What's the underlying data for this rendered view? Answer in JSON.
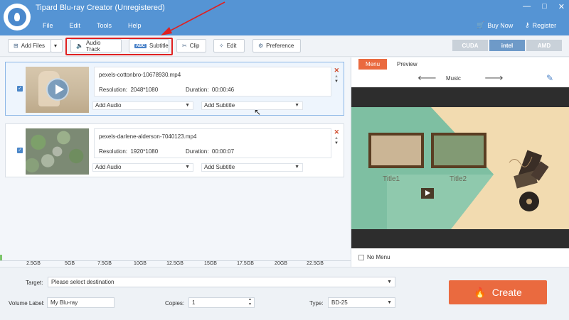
{
  "window": {
    "title": "Tipard Blu-ray Creator (Unregistered)",
    "menu": [
      "File",
      "Edit",
      "Tools",
      "Help"
    ],
    "buy_now": "Buy Now",
    "register": "Register",
    "controls": [
      "—",
      "□",
      "✕"
    ]
  },
  "toolbar": {
    "add_files": "Add Files",
    "audio_track": "Audio Track",
    "subtitle": "Subtitle",
    "clip": "Clip",
    "edit": "Edit",
    "preference": "Preference",
    "abc_badge": "ABC",
    "hw_accel": [
      "CUDA",
      "intel",
      "AMD"
    ]
  },
  "files": [
    {
      "name": "pexels-cottonbro-10678930.mp4",
      "resolution_label": "Resolution:",
      "resolution": "2048*1080",
      "duration_label": "Duration:",
      "duration": "00:00:46",
      "add_audio": "Add Audio",
      "add_subtitle": "Add Subtitle"
    },
    {
      "name": "pexels-darlene-alderson-7040123.mp4",
      "resolution_label": "Resolution:",
      "resolution": "1920*1080",
      "duration_label": "Duration:",
      "duration": "00:00:07",
      "add_audio": "Add Audio",
      "add_subtitle": "Add Subtitle"
    }
  ],
  "capacity": {
    "used_fraction": 0.006,
    "ticks": [
      "2.5GB",
      "5GB",
      "7.5GB",
      "10GB",
      "12.5GB",
      "15GB",
      "17.5GB",
      "20GB",
      "22.5GB"
    ]
  },
  "preview": {
    "tabs": [
      "Menu",
      "Preview"
    ],
    "nav_title": "Music",
    "menu_titles": [
      "Title1",
      "Title2"
    ],
    "no_menu": "No Menu"
  },
  "bottom": {
    "target_label": "Target:",
    "target_placeholder": "Please select destination",
    "volume_label": "Volume Label:",
    "volume_value": "My Blu-ray",
    "copies_label": "Copies:",
    "copies_value": "1",
    "type_label": "Type:",
    "type_value": "BD-25",
    "create": "Create"
  },
  "colors": {
    "titlebar": "#5594d4",
    "accent": "#ea6a3f",
    "highlight": "#e02020"
  }
}
